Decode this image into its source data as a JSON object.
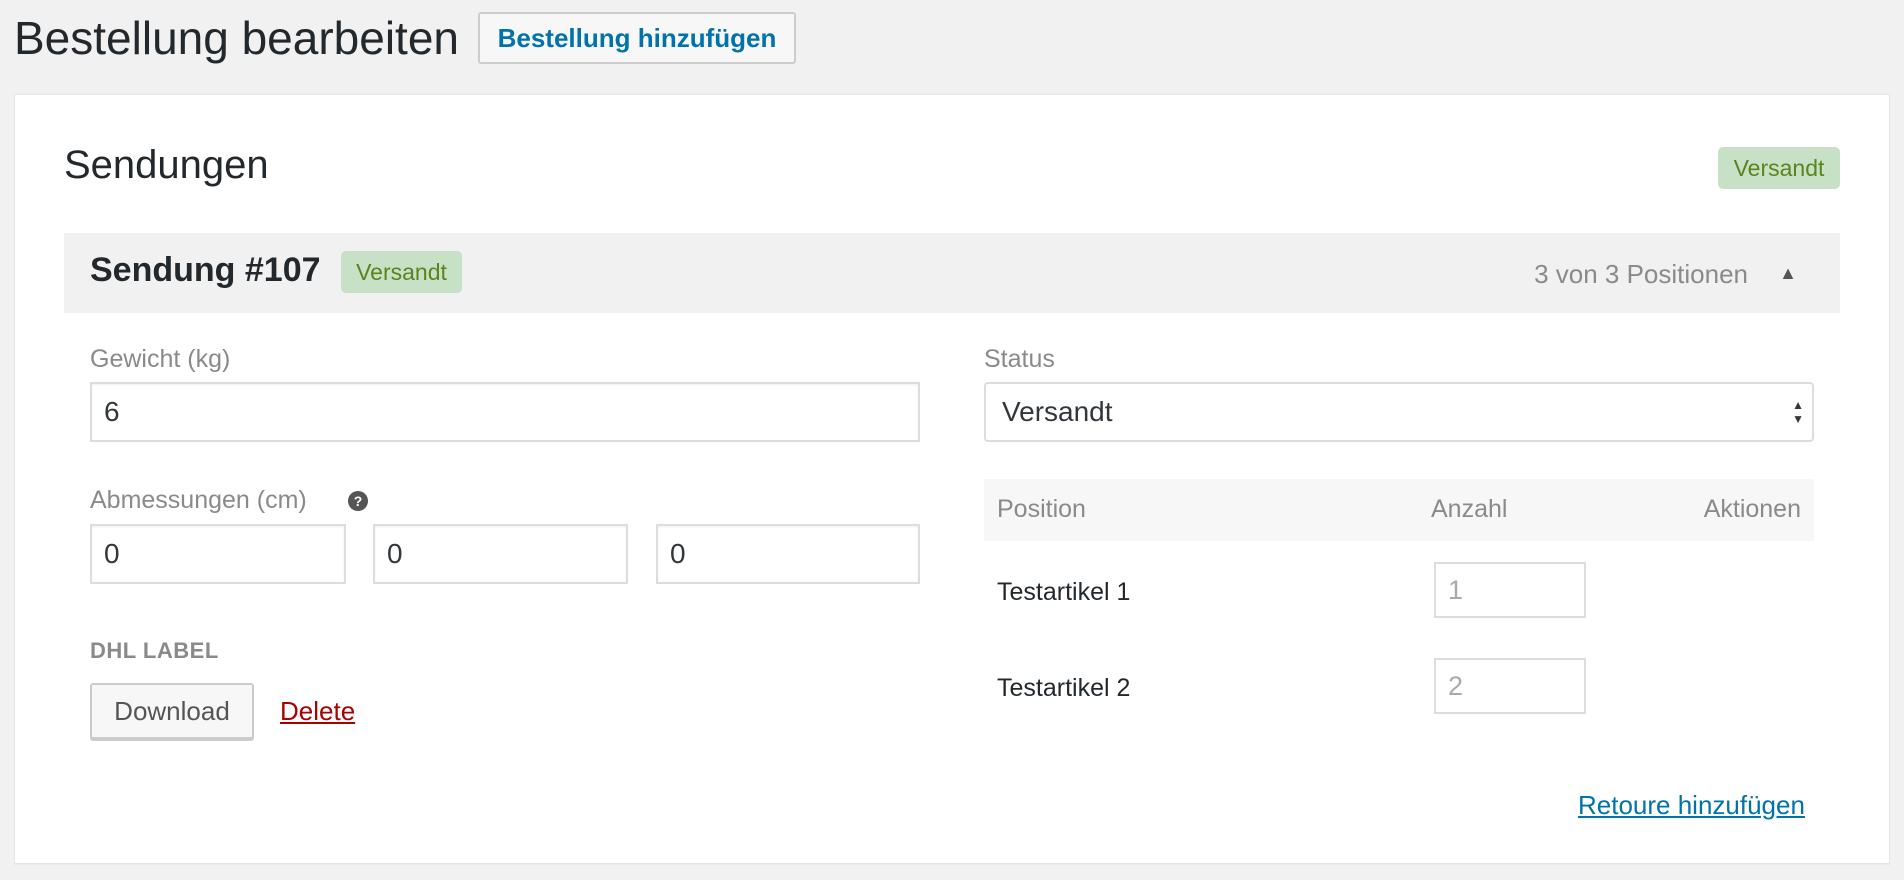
{
  "header": {
    "title": "Bestellung bearbeiten",
    "add_button": "Bestellung hinzufügen"
  },
  "shipments_panel": {
    "title": "Sendungen",
    "status_badge": "Versandt",
    "shipment": {
      "title": "Sendung #107",
      "status_badge": "Versandt",
      "item_count": "3 von 3 Positionen",
      "toggle_icon": "triangle-up-icon",
      "weight": {
        "label": "Gewicht (kg)",
        "value": "6"
      },
      "dimensions": {
        "label": "Abmessungen (cm)",
        "help_icon": "question-circle-icon",
        "values": [
          "0",
          "0",
          "0"
        ]
      },
      "dhl_label": {
        "heading": "DHL LABEL",
        "download": "Download",
        "delete": "Delete"
      },
      "status": {
        "label": "Status",
        "selected": "Versandt"
      },
      "items_table": {
        "headers": [
          "Position",
          "Anzahl",
          "Aktionen"
        ],
        "rows": [
          {
            "name": "Testartikel 1",
            "qty": "1"
          },
          {
            "name": "Testartikel 2",
            "qty": "2"
          }
        ]
      },
      "add_return": "Retoure hinzufügen"
    }
  },
  "colors": {
    "link": "#0073aa",
    "danger": "#a00",
    "badge_bg": "#c6e1c6",
    "badge_text": "#5b841b"
  }
}
